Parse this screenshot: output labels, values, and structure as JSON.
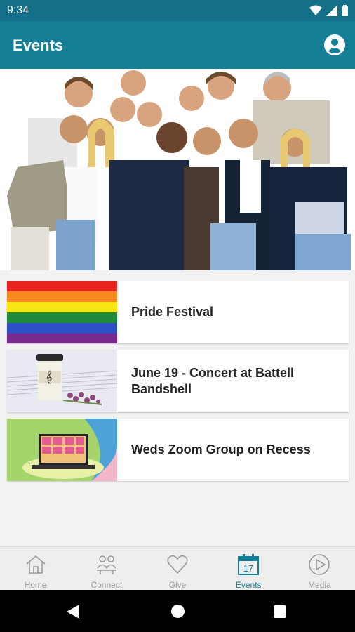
{
  "status_bar": {
    "time": "9:34"
  },
  "app_bar": {
    "title": "Events",
    "profile_icon": "account-circle-icon"
  },
  "events": [
    {
      "title": "Pride Festival",
      "thumbnail": "rainbow-flag"
    },
    {
      "title": "June 19 - Concert at Battell Bandshell",
      "thumbnail": "coffee-cup-sheet-music"
    },
    {
      "title": "Weds Zoom Group on Recess",
      "thumbnail": "laptop-video-call"
    }
  ],
  "bottom_nav": {
    "items": [
      {
        "label": "Home",
        "icon": "home-icon"
      },
      {
        "label": "Connect",
        "icon": "people-icon"
      },
      {
        "label": "Give",
        "icon": "heart-icon"
      },
      {
        "label": "Events",
        "icon": "calendar-icon",
        "badge": "17",
        "active": true
      },
      {
        "label": "Media",
        "icon": "play-icon"
      }
    ]
  },
  "colors": {
    "primary": "#167f98",
    "status_bar": "#137088",
    "inactive": "#9a9a9a"
  }
}
